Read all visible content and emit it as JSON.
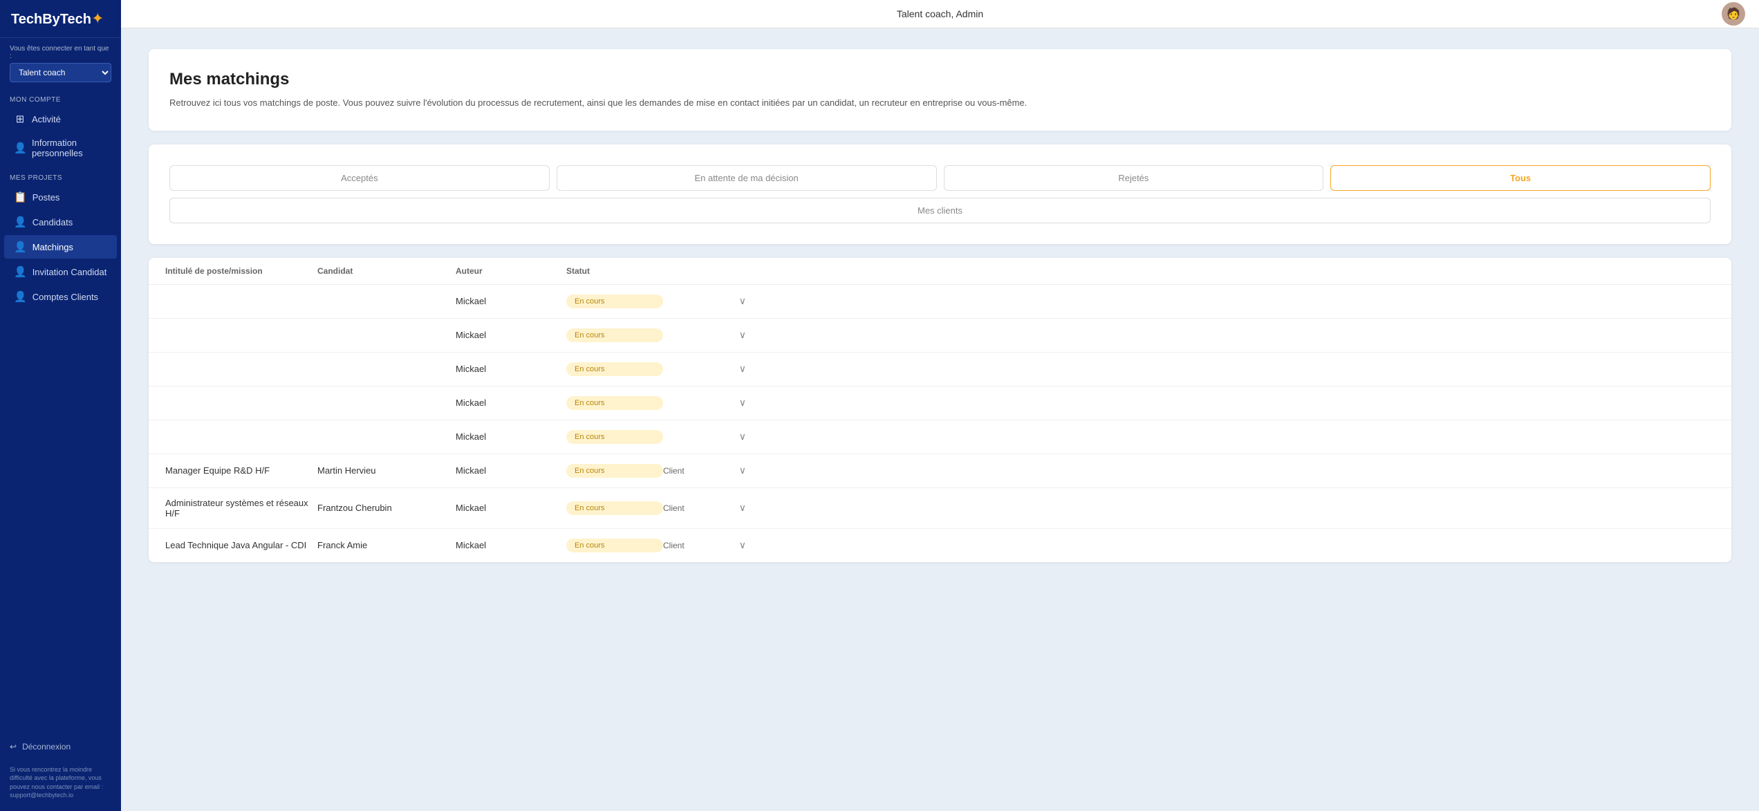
{
  "app": {
    "logo_text": "TechByTech",
    "logo_star": "✦"
  },
  "topbar": {
    "title": "Talent coach, Admin"
  },
  "sidebar": {
    "role_label": "Vous êtes connecter en tant que :",
    "role_value": "Talent coach",
    "sections": [
      {
        "title": "MON COMPTE",
        "items": [
          {
            "label": "Activité",
            "icon": "⊞",
            "active": false
          },
          {
            "label": "Information personnelles",
            "icon": "👤",
            "active": false
          }
        ]
      },
      {
        "title": "MES PROJETS",
        "items": [
          {
            "label": "Postes",
            "icon": "📋",
            "active": false
          },
          {
            "label": "Candidats",
            "icon": "👤",
            "active": false
          },
          {
            "label": "Matchings",
            "icon": "👤",
            "active": true
          },
          {
            "label": "Invitation Candidat",
            "icon": "👤",
            "active": false
          },
          {
            "label": "Comptes Clients",
            "icon": "👤",
            "active": false
          }
        ]
      }
    ],
    "logout_label": "Déconnexion",
    "support_text": "Si vous rencontrez la moindre difficulté avec la plateforme, vous pouvez nous contacter par email : support@techbytech.io"
  },
  "main": {
    "title": "Mes matchings",
    "subtitle": "Retrouvez ici tous vos matchings de poste. Vous pouvez suivre l'évolution du processus de recrutement, ainsi que les demandes de mise en contact initiées par un candidat, un recruteur en entreprise ou vous-même.",
    "filters": {
      "acceptes": "Acceptés",
      "en_attente": "En attente de ma décision",
      "rejetes": "Rejetés",
      "tous": "Tous",
      "mes_clients": "Mes clients"
    },
    "table": {
      "columns": [
        "Intitulé de poste/mission",
        "Candidat",
        "Auteur",
        "Statut",
        ""
      ],
      "status_label": "En cours",
      "rows": [
        {
          "poste": "",
          "candidat": "",
          "auteur": "Mickael",
          "statut": "En cours",
          "extra": "",
          "chevron": "∨"
        },
        {
          "poste": "",
          "candidat": "",
          "auteur": "Mickael",
          "statut": "En cours",
          "extra": "",
          "chevron": "∨"
        },
        {
          "poste": "",
          "candidat": "",
          "auteur": "Mickael",
          "statut": "En cours",
          "extra": "",
          "chevron": "∨"
        },
        {
          "poste": "",
          "candidat": "",
          "auteur": "Mickael",
          "statut": "En cours",
          "extra": "",
          "chevron": "∨"
        },
        {
          "poste": "",
          "candidat": "",
          "auteur": "Mickael",
          "statut": "En cours",
          "extra": "",
          "chevron": "∨"
        },
        {
          "poste": "Manager Equipe R&D H/F",
          "candidat": "Martin Hervieu",
          "auteur": "Mickael",
          "statut": "En cours",
          "extra": "Client",
          "chevron": "∨"
        },
        {
          "poste": "Administrateur systèmes et réseaux H/F",
          "candidat": "Frantzou Cherubin",
          "auteur": "Mickael",
          "statut": "En cours",
          "extra": "Client",
          "chevron": "∨"
        },
        {
          "poste": "Lead Technique Java Angular - CDI",
          "candidat": "Franck Amie",
          "auteur": "Mickael",
          "statut": "En cours",
          "extra": "Client",
          "chevron": "∨"
        }
      ]
    }
  }
}
